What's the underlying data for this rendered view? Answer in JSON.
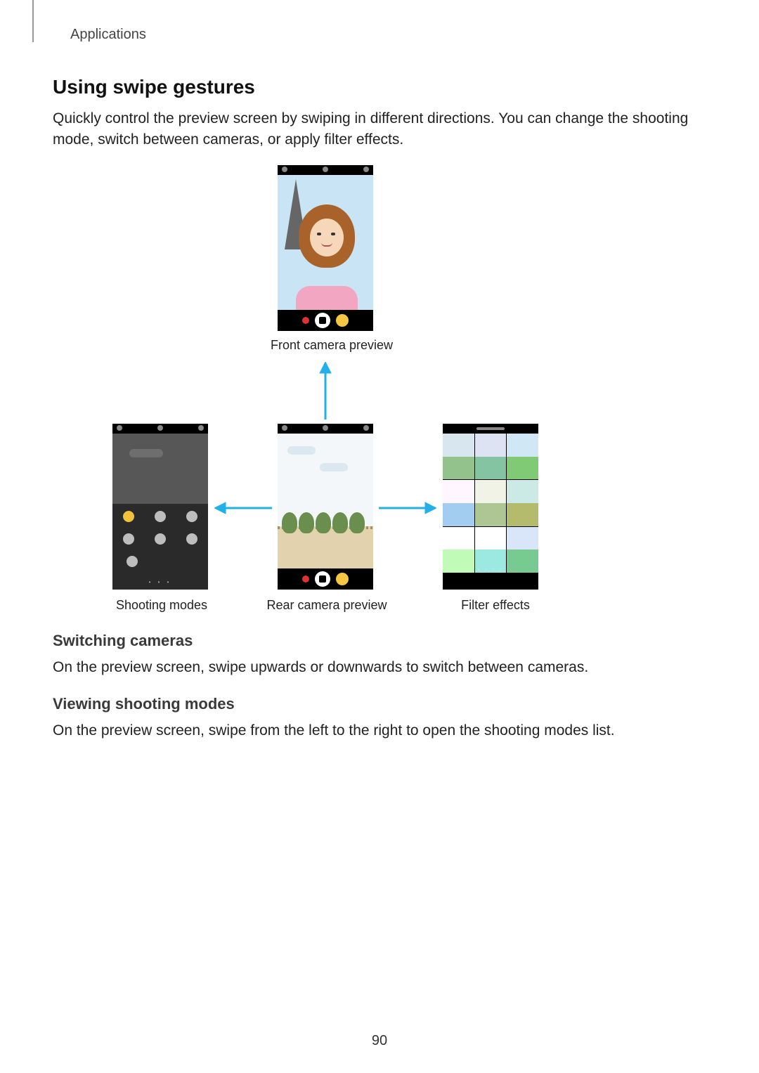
{
  "header": {
    "section": "Applications"
  },
  "h2": "Using swipe gestures",
  "intro": "Quickly control the preview screen by swiping in different directions. You can change the shooting mode, switch between cameras, or apply filter effects.",
  "captions": {
    "front": "Front camera preview",
    "modes": "Shooting modes",
    "rear": "Rear camera preview",
    "filters": "Filter effects"
  },
  "sub1_h": "Switching cameras",
  "sub1_p": "On the preview screen, swipe upwards or downwards to switch between cameras.",
  "sub2_h": "Viewing shooting modes",
  "sub2_p": "On the preview screen, swipe from the left to the right to open the shooting modes list.",
  "page_number": "90"
}
